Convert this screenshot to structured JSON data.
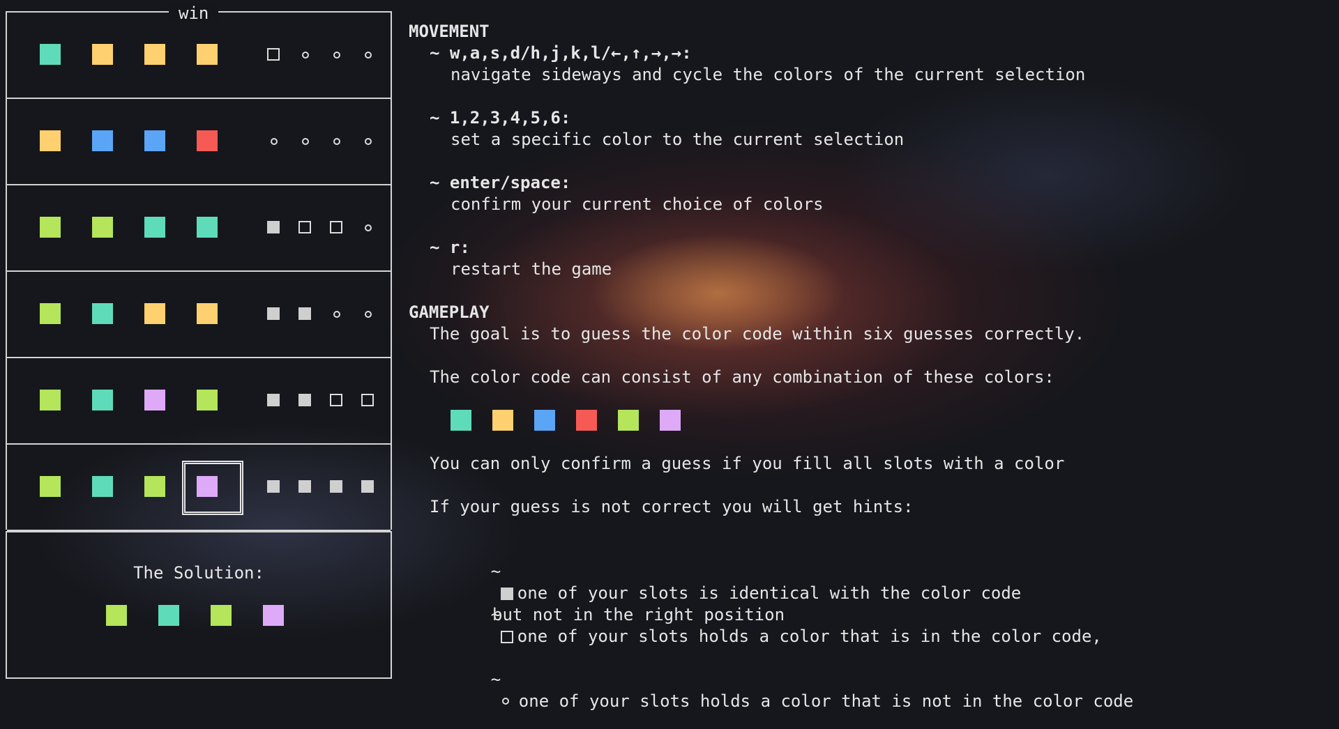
{
  "board": {
    "status_label": "win",
    "colors": {
      "teal": "#5edcb9",
      "yellow": "#ffd070",
      "blue": "#5aa5f5",
      "red": "#f65a55",
      "green": "#b4e55a",
      "purple": "#deaaf8"
    },
    "rows": [
      {
        "pegs": [
          "teal",
          "yellow",
          "yellow",
          "yellow"
        ],
        "hints": [
          "hollow",
          "dot",
          "dot",
          "dot"
        ]
      },
      {
        "pegs": [
          "yellow",
          "blue",
          "blue",
          "red"
        ],
        "hints": [
          "dot",
          "dot",
          "dot",
          "dot"
        ]
      },
      {
        "pegs": [
          "green",
          "green",
          "teal",
          "teal"
        ],
        "hints": [
          "filled",
          "hollow",
          "hollow",
          "dot"
        ]
      },
      {
        "pegs": [
          "green",
          "teal",
          "yellow",
          "yellow"
        ],
        "hints": [
          "filled",
          "filled",
          "dot",
          "dot"
        ]
      },
      {
        "pegs": [
          "green",
          "teal",
          "purple",
          "green"
        ],
        "hints": [
          "filled",
          "filled",
          "hollow",
          "hollow"
        ]
      },
      {
        "pegs": [
          "green",
          "teal",
          "green",
          "purple"
        ],
        "hints": [
          "filled",
          "filled",
          "filled",
          "filled"
        ],
        "selected_index": 3
      }
    ],
    "solution_title": "The Solution:",
    "solution": [
      "green",
      "teal",
      "green",
      "purple"
    ]
  },
  "help": {
    "movement_heading": "MOVEMENT",
    "keys": [
      {
        "label": "~ w,a,s,d/h,j,k,l/←,↑,→,→:",
        "desc": "navigate sideways and cycle the colors of the current selection"
      },
      {
        "label": "~ 1,2,3,4,5,6:",
        "desc": "set a specific color to the current selection"
      },
      {
        "label": "~ enter/space:",
        "desc": "confirm your current choice of colors"
      },
      {
        "label": "~ r:",
        "desc": "restart the game"
      }
    ],
    "gameplay_heading": "GAMEPLAY",
    "goal_text": "The goal is to guess the color code within six guesses correctly.",
    "colors_text": "The color code can consist of any combination of these colors:",
    "palette": [
      "teal",
      "yellow",
      "blue",
      "red",
      "green",
      "purple"
    ],
    "confirm_text": "You can only confirm a guess if you fill all slots with a color",
    "hints_intro": "If your guess is not correct you will get hints:",
    "hint_filled": "one of your slots is identical with the color code",
    "hint_hollow_1": "one of your slots holds a color that is in the color code,",
    "hint_hollow_2": "but not in the right position",
    "hint_dot": "one of your slots holds a color that is not in the color code",
    "tilde": "~"
  }
}
